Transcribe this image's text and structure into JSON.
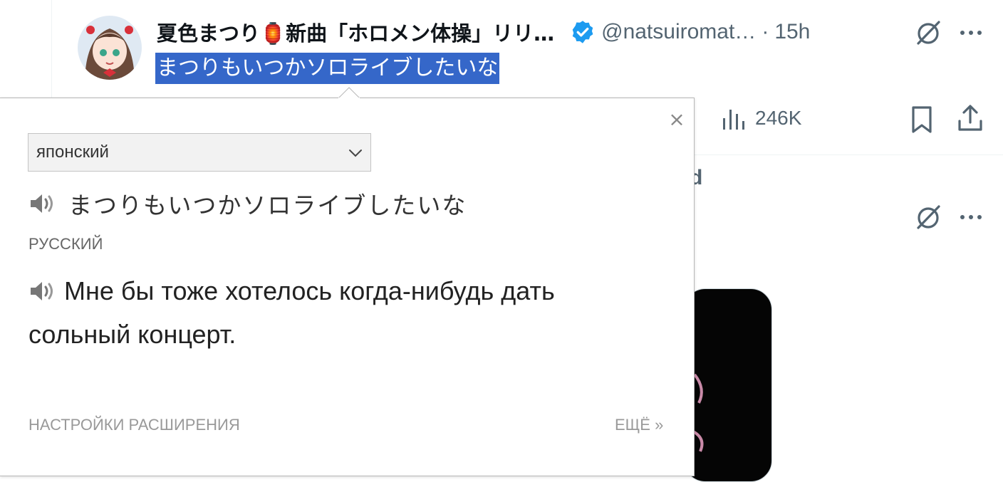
{
  "tweet": {
    "display_name": "夏色まつり🏮新曲「ホロメン体操」リリ…",
    "handle": "@natsuiromat…",
    "separator": "·",
    "time": "15h",
    "text": "まつりもいつかソロライブしたいな",
    "views": "246K"
  },
  "next_tweet": {
    "peek_text": "d"
  },
  "translator": {
    "source_language": "японский",
    "source_text": "まつりもいつかソロライブしたいな",
    "target_language": "РУССКИЙ",
    "translation": "Мне бы тоже хотелось когда-нибудь дать сольный концерт.",
    "close_label": "×",
    "settings_label": "НАСТРОЙКИ РАСШИРЕНИЯ",
    "more_label": "ЕЩЁ »"
  },
  "colors": {
    "selection": "#3567c9",
    "verified": "#1d9bf0",
    "secondary_text": "#536471"
  },
  "icons": [
    "verified-badge-icon",
    "grok-icon",
    "more-icon",
    "views-icon",
    "bookmark-icon",
    "share-icon",
    "speaker-icon",
    "chevron-down-icon",
    "close-icon"
  ]
}
